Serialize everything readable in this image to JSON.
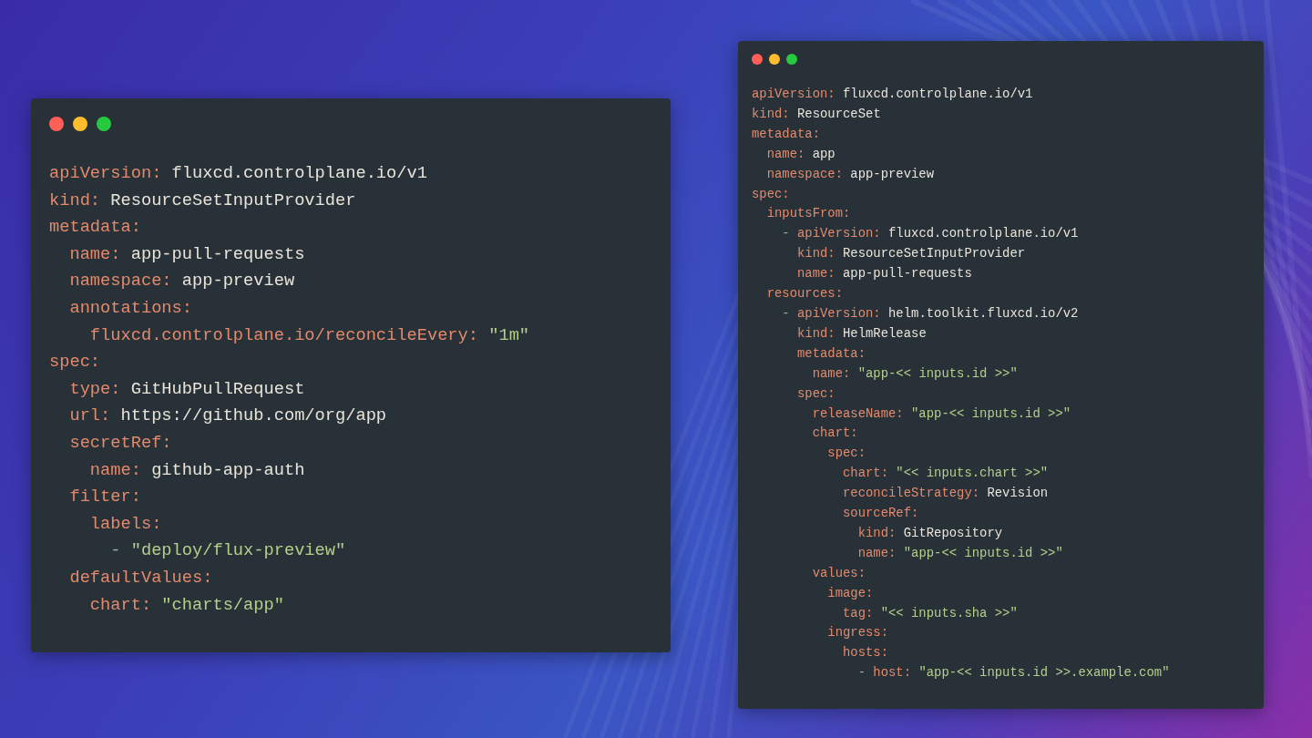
{
  "windows": [
    {
      "lines": [
        {
          "key": "apiVersion:",
          "value": "fluxcd.controlplane.io/v1",
          "kind": "plain"
        },
        {
          "key": "kind:",
          "value": "ResourceSetInputProvider",
          "kind": "plain"
        },
        {
          "key": "metadata:",
          "children": [
            {
              "key": "name:",
              "value": "app-pull-requests",
              "kind": "plain"
            },
            {
              "key": "namespace:",
              "value": "app-preview",
              "kind": "plain"
            },
            {
              "key": "annotations:",
              "children": [
                {
                  "key": "fluxcd.controlplane.io/reconcileEvery:",
                  "value": "\"1m\"",
                  "kind": "string"
                }
              ]
            }
          ]
        },
        {
          "key": "spec:",
          "children": [
            {
              "key": "type:",
              "value": "GitHubPullRequest",
              "kind": "plain"
            },
            {
              "key": "url:",
              "value": "https://github.com/org/app",
              "kind": "plain"
            },
            {
              "key": "secretRef:",
              "children": [
                {
                  "key": "name:",
                  "value": "github-app-auth",
                  "kind": "plain"
                }
              ]
            },
            {
              "key": "filter:",
              "children": [
                {
                  "key": "labels:",
                  "children": [
                    {
                      "dash": "-",
                      "value": "\"deploy/flux-preview\"",
                      "kind": "string"
                    }
                  ]
                }
              ]
            },
            {
              "key": "defaultValues:",
              "children": [
                {
                  "key": "chart:",
                  "value": "\"charts/app\"",
                  "kind": "string"
                }
              ]
            }
          ]
        }
      ]
    },
    {
      "lines": [
        {
          "key": "apiVersion:",
          "value": "fluxcd.controlplane.io/v1",
          "kind": "plain"
        },
        {
          "key": "kind:",
          "value": "ResourceSet",
          "kind": "plain"
        },
        {
          "key": "metadata:",
          "children": [
            {
              "key": "name:",
              "value": "app",
              "kind": "plain"
            },
            {
              "key": "namespace:",
              "value": "app-preview",
              "kind": "plain"
            }
          ]
        },
        {
          "key": "spec:",
          "children": [
            {
              "key": "inputsFrom:",
              "children": [
                {
                  "dash": "-",
                  "key": "apiVersion:",
                  "value": "fluxcd.controlplane.io/v1",
                  "kind": "plain",
                  "siblings": [
                    {
                      "key": "kind:",
                      "value": "ResourceSetInputProvider",
                      "kind": "plain"
                    },
                    {
                      "key": "name:",
                      "value": "app-pull-requests",
                      "kind": "plain"
                    }
                  ]
                }
              ]
            },
            {
              "key": "resources:",
              "children": [
                {
                  "dash": "-",
                  "key": "apiVersion:",
                  "value": "helm.toolkit.fluxcd.io/v2",
                  "kind": "plain",
                  "siblings": [
                    {
                      "key": "kind:",
                      "value": "HelmRelease",
                      "kind": "plain"
                    },
                    {
                      "key": "metadata:",
                      "children": [
                        {
                          "key": "name:",
                          "value": "\"app-<< inputs.id >>\"",
                          "kind": "string"
                        }
                      ]
                    },
                    {
                      "key": "spec:",
                      "children": [
                        {
                          "key": "releaseName:",
                          "value": "\"app-<< inputs.id >>\"",
                          "kind": "string"
                        },
                        {
                          "key": "chart:",
                          "children": [
                            {
                              "key": "spec:",
                              "children": [
                                {
                                  "key": "chart:",
                                  "value": "\"<< inputs.chart >>\"",
                                  "kind": "string"
                                },
                                {
                                  "key": "reconcileStrategy:",
                                  "value": "Revision",
                                  "kind": "plain"
                                },
                                {
                                  "key": "sourceRef:",
                                  "children": [
                                    {
                                      "key": "kind:",
                                      "value": "GitRepository",
                                      "kind": "plain"
                                    },
                                    {
                                      "key": "name:",
                                      "value": "\"app-<< inputs.id >>\"",
                                      "kind": "string"
                                    }
                                  ]
                                }
                              ]
                            }
                          ]
                        },
                        {
                          "key": "values:",
                          "children": [
                            {
                              "key": "image:",
                              "children": [
                                {
                                  "key": "tag:",
                                  "value": "\"<< inputs.sha >>\"",
                                  "kind": "string"
                                }
                              ]
                            },
                            {
                              "key": "ingress:",
                              "children": [
                                {
                                  "key": "hosts:",
                                  "children": [
                                    {
                                      "dash": "-",
                                      "key": "host:",
                                      "value": "\"app-<< inputs.id >>.example.com\"",
                                      "kind": "string"
                                    }
                                  ]
                                }
                              ]
                            }
                          ]
                        }
                      ]
                    }
                  ]
                }
              ]
            }
          ]
        }
      ]
    }
  ]
}
